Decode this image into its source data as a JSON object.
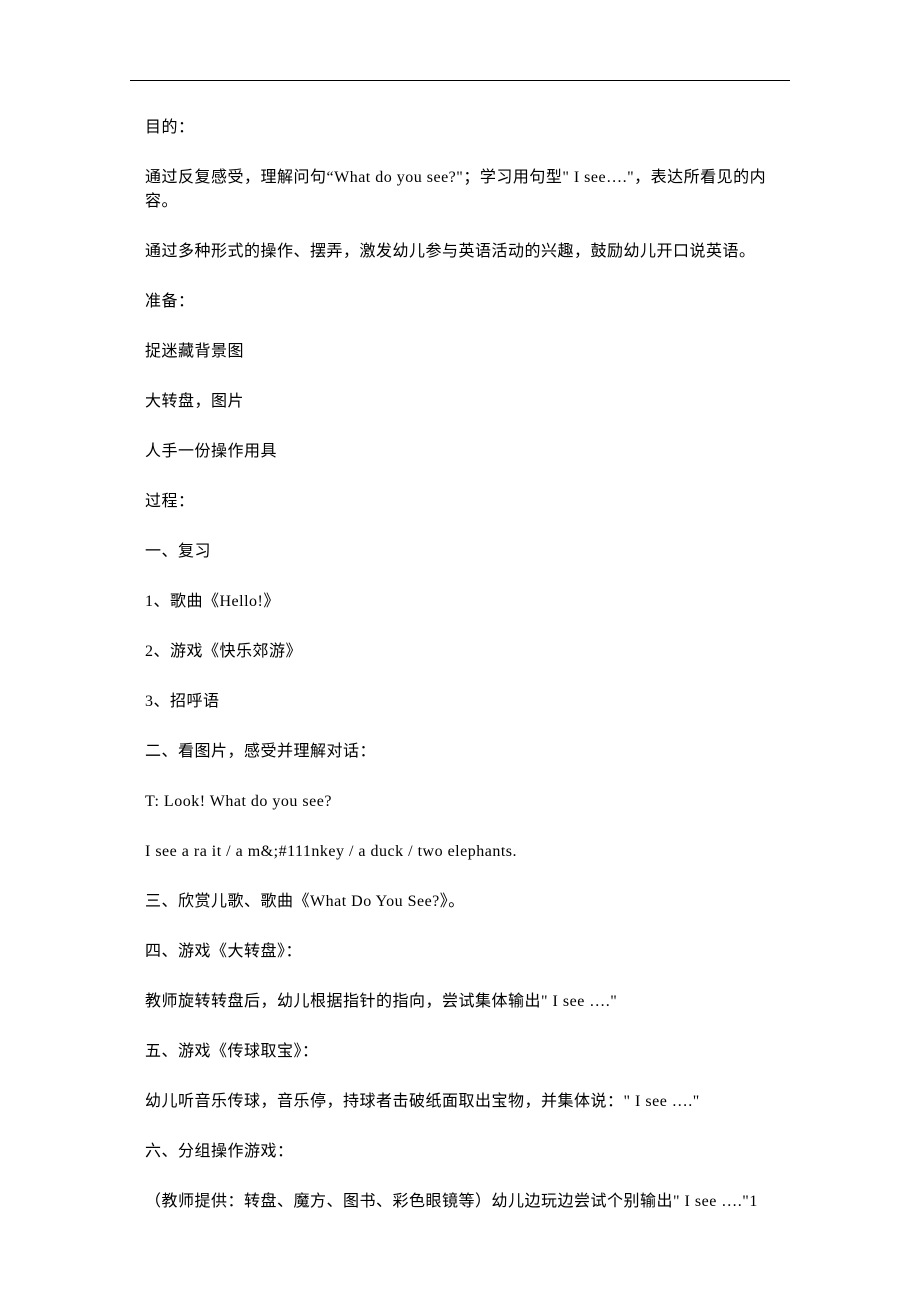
{
  "document": {
    "paragraphs": [
      "目的：",
      "通过反复感受，理解问句“What do you see?\"；学习用句型\" I see….\"，表达所看见的内容。",
      "通过多种形式的操作、摆弄，激发幼儿参与英语活动的兴趣，鼓励幼儿开口说英语。",
      "准备：",
      "捉迷藏背景图",
      "大转盘，图片",
      "人手一份操作用具",
      "过程：",
      "一、复习",
      "1、歌曲《Hello!》",
      "2、游戏《快乐郊游》",
      "3、招呼语",
      "二、看图片，感受并理解对话：",
      "T: Look! What do you see?",
      "I see a ra it / a m&;#111nkey / a duck / two elephants.",
      "三、欣赏儿歌、歌曲《What Do You See?》。",
      "四、游戏《大转盘》：",
      "教师旋转转盘后，幼儿根据指针的指向，尝试集体输出\" I see  ….\"",
      "五、游戏《传球取宝》：",
      "幼儿听音乐传球，音乐停，持球者击破纸面取出宝物，并集体说：\" I see  ….\"",
      "六、分组操作游戏：",
      "（教师提供：转盘、魔方、图书、彩色眼镜等）幼儿边玩边尝试个别输出\" I see  ….\"1"
    ]
  }
}
